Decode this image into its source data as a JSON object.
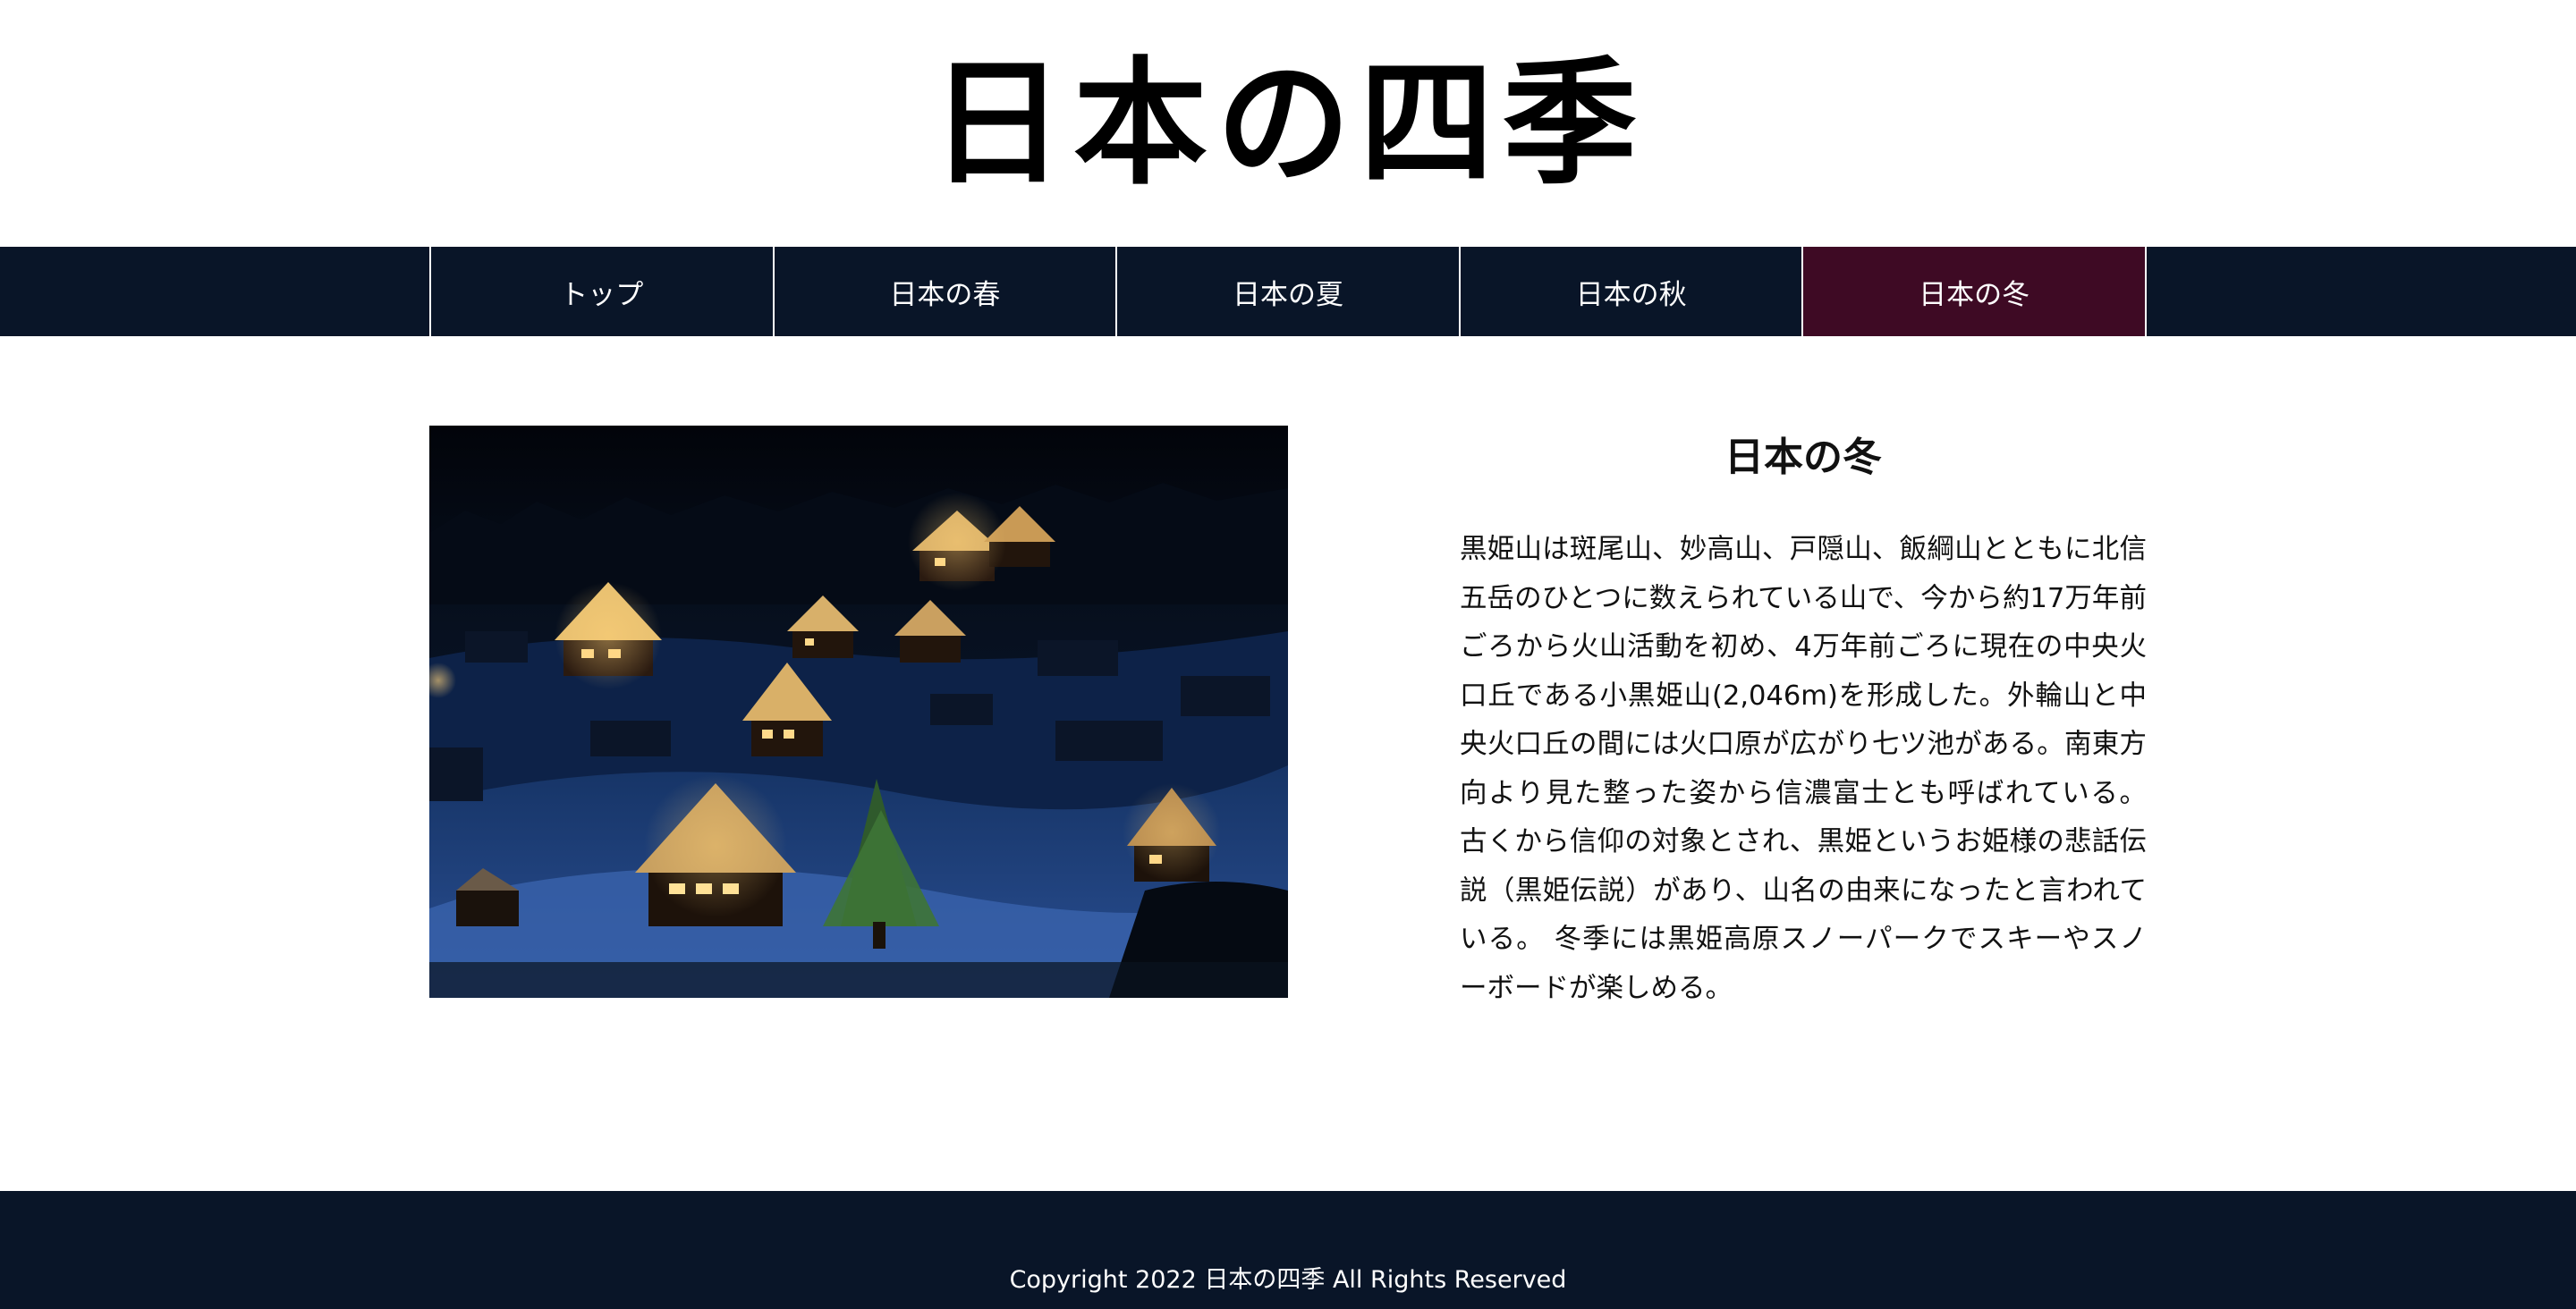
{
  "site": {
    "title": "日本の四季"
  },
  "nav": {
    "items": [
      {
        "label": "トップ"
      },
      {
        "label": "日本の春"
      },
      {
        "label": "日本の夏"
      },
      {
        "label": "日本の秋"
      },
      {
        "label": "日本の冬"
      }
    ],
    "active_label": "日本の冬"
  },
  "main": {
    "image_icon": "snowy-village-night-photo",
    "title": "日本の冬",
    "body": "黒姫山は斑尾山、妙高山、戸隠山、飯綱山とともに北信五岳のひとつに数えられている山で、今から約17万年前ごろから火山活動を初め、4万年前ごろに現在の中央火口丘である小黒姫山(2,046m)を形成した。外輪山と中央火口丘の間には火口原が広がり七ツ池がある。南東方向より見た整った姿から信濃富士とも呼ばれている。 古くから信仰の対象とされ、黒姫というお姫様の悲話伝説（黒姫伝説）があり、山名の由来になったと言われている。 冬季には黒姫高原スノーパークでスキーやスノーボードが楽しめる。"
  },
  "footer": {
    "copyright": "Copyright 2022 日本の四季 All Rights Reserved"
  },
  "colors": {
    "nav_background": "#091528",
    "nav_active": "#3e0a24",
    "footer_background": "#091528",
    "text": "#111111"
  }
}
